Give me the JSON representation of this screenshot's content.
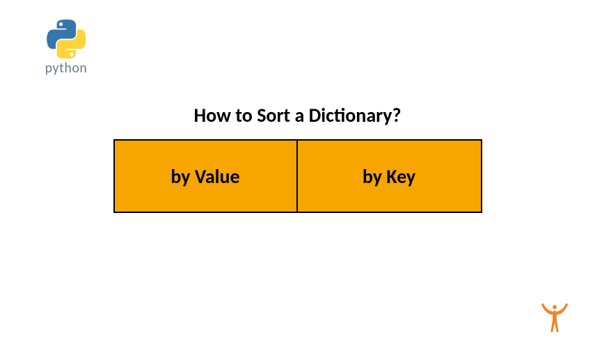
{
  "logo": {
    "label": "python"
  },
  "title": "How to Sort a Dictionary?",
  "options": {
    "left": "by Value",
    "right": "by Key"
  },
  "colors": {
    "accent": "#f7a600",
    "python_blue": "#3776ab",
    "python_yellow": "#ffd43b",
    "icon_orange": "#f58220"
  }
}
